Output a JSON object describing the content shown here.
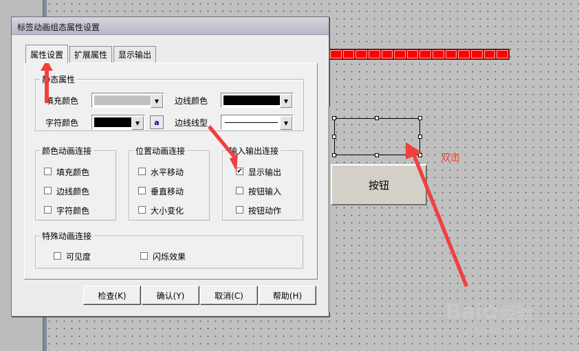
{
  "dialog": {
    "title": "标签动画组态属性设置",
    "tabs": [
      {
        "label": "属性设置",
        "active": true
      },
      {
        "label": "扩展属性",
        "active": false
      },
      {
        "label": "显示输出",
        "active": false
      }
    ],
    "static_props": {
      "group_label": "静态属性",
      "fill_color_label": "填充颜色",
      "border_color_label": "边线颜色",
      "text_color_label": "字符颜色",
      "border_style_label": "边线线型",
      "font_button_label": "a",
      "fill_color": "#c0c0c0",
      "border_color": "#000000",
      "text_color": "#000000"
    },
    "color_anim": {
      "group_label": "颜色动画连接",
      "items": [
        {
          "label": "填充颜色",
          "checked": false
        },
        {
          "label": "边线颜色",
          "checked": false
        },
        {
          "label": "字符颜色",
          "checked": false
        }
      ]
    },
    "position_anim": {
      "group_label": "位置动画连接",
      "items": [
        {
          "label": "水平移动",
          "checked": false
        },
        {
          "label": "垂直移动",
          "checked": false
        },
        {
          "label": "大小变化",
          "checked": false
        }
      ]
    },
    "io_link": {
      "group_label": "输入输出连接",
      "items": [
        {
          "label": "显示输出",
          "checked": true
        },
        {
          "label": "按钮输入",
          "checked": false
        },
        {
          "label": "按钮动作",
          "checked": false
        }
      ]
    },
    "special_anim": {
      "group_label": "特殊动画连接",
      "items": [
        {
          "label": "可见度",
          "checked": false
        },
        {
          "label": "闪烁效果",
          "checked": false
        }
      ]
    },
    "buttons": {
      "check": "检查(K)",
      "confirm": "确认(Y)",
      "cancel": "取消(C)",
      "help": "帮助(H)"
    }
  },
  "canvas": {
    "button_label": "按钮",
    "annotation": "双击",
    "annotation_color": "#e8443b"
  },
  "watermark": {
    "brand": "Bai",
    "brand_suffix": "经验",
    "url": "jingyan.baidu.com"
  }
}
